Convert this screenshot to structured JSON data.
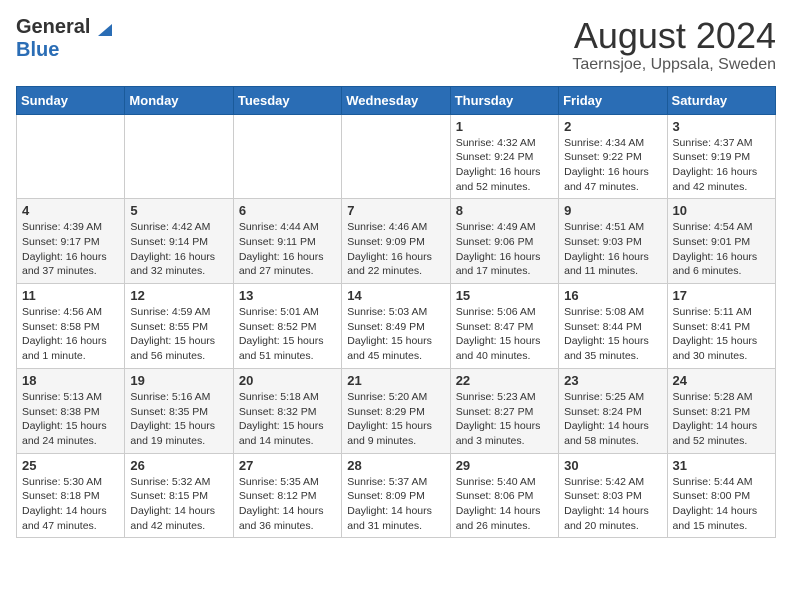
{
  "logo": {
    "general": "General",
    "blue": "Blue"
  },
  "title": "August 2024",
  "subtitle": "Taernsjoe, Uppsala, Sweden",
  "weekdays": [
    "Sunday",
    "Monday",
    "Tuesday",
    "Wednesday",
    "Thursday",
    "Friday",
    "Saturday"
  ],
  "weeks": [
    [
      {
        "day": "",
        "info": ""
      },
      {
        "day": "",
        "info": ""
      },
      {
        "day": "",
        "info": ""
      },
      {
        "day": "",
        "info": ""
      },
      {
        "day": "1",
        "info": "Sunrise: 4:32 AM\nSunset: 9:24 PM\nDaylight: 16 hours\nand 52 minutes."
      },
      {
        "day": "2",
        "info": "Sunrise: 4:34 AM\nSunset: 9:22 PM\nDaylight: 16 hours\nand 47 minutes."
      },
      {
        "day": "3",
        "info": "Sunrise: 4:37 AM\nSunset: 9:19 PM\nDaylight: 16 hours\nand 42 minutes."
      }
    ],
    [
      {
        "day": "4",
        "info": "Sunrise: 4:39 AM\nSunset: 9:17 PM\nDaylight: 16 hours\nand 37 minutes."
      },
      {
        "day": "5",
        "info": "Sunrise: 4:42 AM\nSunset: 9:14 PM\nDaylight: 16 hours\nand 32 minutes."
      },
      {
        "day": "6",
        "info": "Sunrise: 4:44 AM\nSunset: 9:11 PM\nDaylight: 16 hours\nand 27 minutes."
      },
      {
        "day": "7",
        "info": "Sunrise: 4:46 AM\nSunset: 9:09 PM\nDaylight: 16 hours\nand 22 minutes."
      },
      {
        "day": "8",
        "info": "Sunrise: 4:49 AM\nSunset: 9:06 PM\nDaylight: 16 hours\nand 17 minutes."
      },
      {
        "day": "9",
        "info": "Sunrise: 4:51 AM\nSunset: 9:03 PM\nDaylight: 16 hours\nand 11 minutes."
      },
      {
        "day": "10",
        "info": "Sunrise: 4:54 AM\nSunset: 9:01 PM\nDaylight: 16 hours\nand 6 minutes."
      }
    ],
    [
      {
        "day": "11",
        "info": "Sunrise: 4:56 AM\nSunset: 8:58 PM\nDaylight: 16 hours\nand 1 minute."
      },
      {
        "day": "12",
        "info": "Sunrise: 4:59 AM\nSunset: 8:55 PM\nDaylight: 15 hours\nand 56 minutes."
      },
      {
        "day": "13",
        "info": "Sunrise: 5:01 AM\nSunset: 8:52 PM\nDaylight: 15 hours\nand 51 minutes."
      },
      {
        "day": "14",
        "info": "Sunrise: 5:03 AM\nSunset: 8:49 PM\nDaylight: 15 hours\nand 45 minutes."
      },
      {
        "day": "15",
        "info": "Sunrise: 5:06 AM\nSunset: 8:47 PM\nDaylight: 15 hours\nand 40 minutes."
      },
      {
        "day": "16",
        "info": "Sunrise: 5:08 AM\nSunset: 8:44 PM\nDaylight: 15 hours\nand 35 minutes."
      },
      {
        "day": "17",
        "info": "Sunrise: 5:11 AM\nSunset: 8:41 PM\nDaylight: 15 hours\nand 30 minutes."
      }
    ],
    [
      {
        "day": "18",
        "info": "Sunrise: 5:13 AM\nSunset: 8:38 PM\nDaylight: 15 hours\nand 24 minutes."
      },
      {
        "day": "19",
        "info": "Sunrise: 5:16 AM\nSunset: 8:35 PM\nDaylight: 15 hours\nand 19 minutes."
      },
      {
        "day": "20",
        "info": "Sunrise: 5:18 AM\nSunset: 8:32 PM\nDaylight: 15 hours\nand 14 minutes."
      },
      {
        "day": "21",
        "info": "Sunrise: 5:20 AM\nSunset: 8:29 PM\nDaylight: 15 hours\nand 9 minutes."
      },
      {
        "day": "22",
        "info": "Sunrise: 5:23 AM\nSunset: 8:27 PM\nDaylight: 15 hours\nand 3 minutes."
      },
      {
        "day": "23",
        "info": "Sunrise: 5:25 AM\nSunset: 8:24 PM\nDaylight: 14 hours\nand 58 minutes."
      },
      {
        "day": "24",
        "info": "Sunrise: 5:28 AM\nSunset: 8:21 PM\nDaylight: 14 hours\nand 52 minutes."
      }
    ],
    [
      {
        "day": "25",
        "info": "Sunrise: 5:30 AM\nSunset: 8:18 PM\nDaylight: 14 hours\nand 47 minutes."
      },
      {
        "day": "26",
        "info": "Sunrise: 5:32 AM\nSunset: 8:15 PM\nDaylight: 14 hours\nand 42 minutes."
      },
      {
        "day": "27",
        "info": "Sunrise: 5:35 AM\nSunset: 8:12 PM\nDaylight: 14 hours\nand 36 minutes."
      },
      {
        "day": "28",
        "info": "Sunrise: 5:37 AM\nSunset: 8:09 PM\nDaylight: 14 hours\nand 31 minutes."
      },
      {
        "day": "29",
        "info": "Sunrise: 5:40 AM\nSunset: 8:06 PM\nDaylight: 14 hours\nand 26 minutes."
      },
      {
        "day": "30",
        "info": "Sunrise: 5:42 AM\nSunset: 8:03 PM\nDaylight: 14 hours\nand 20 minutes."
      },
      {
        "day": "31",
        "info": "Sunrise: 5:44 AM\nSunset: 8:00 PM\nDaylight: 14 hours\nand 15 minutes."
      }
    ]
  ]
}
